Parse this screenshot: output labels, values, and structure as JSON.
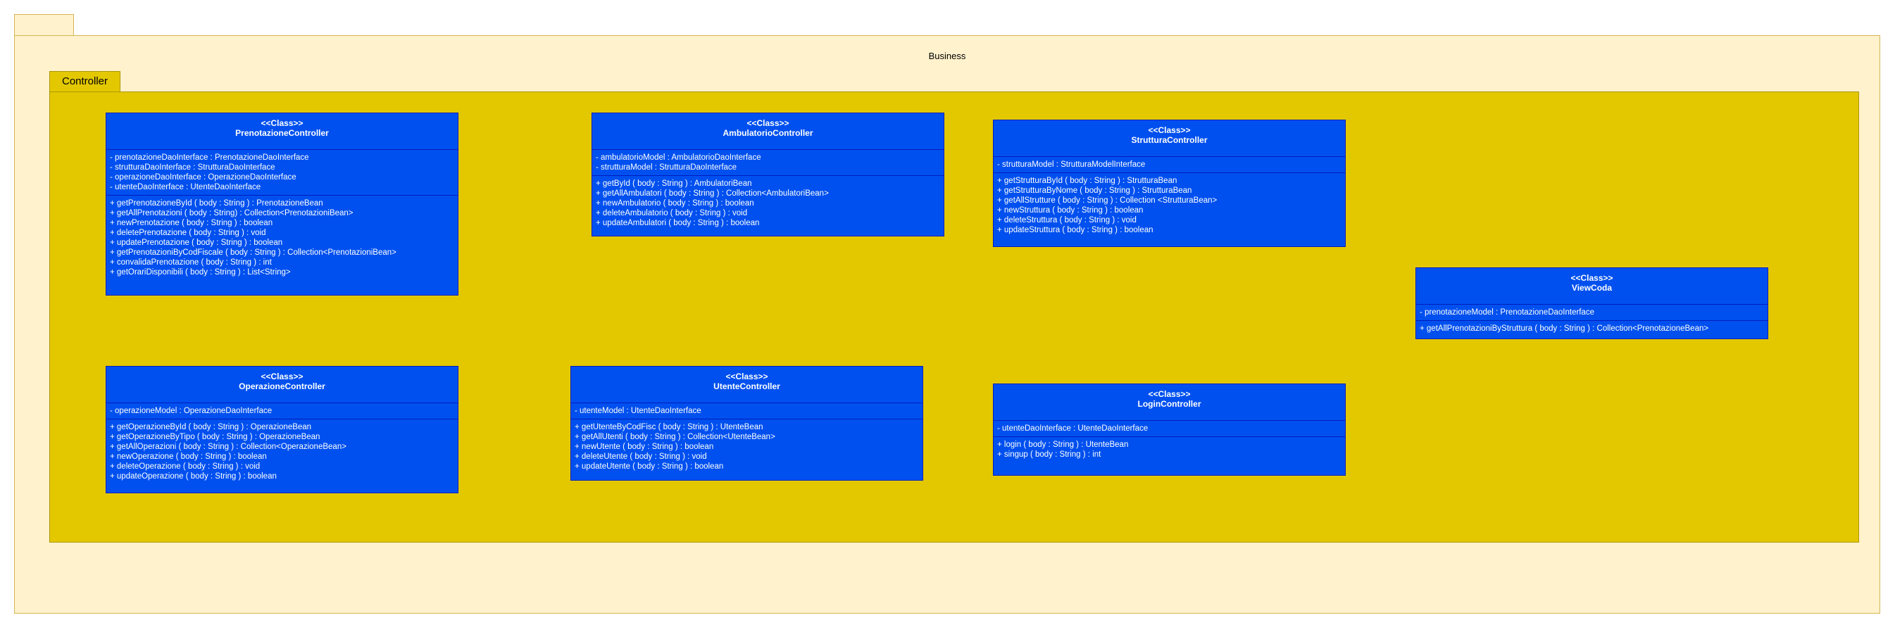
{
  "package": {
    "name": "Business"
  },
  "subpackage": {
    "name": "Controller"
  },
  "classes": [
    {
      "stereotype": "<<Class>>",
      "name": "PrenotazioneController",
      "attributes": [
        "- prenotazioneDaoInterface : PrenotazioneDaoInterface",
        "- strutturaDaoInterface : StrutturaDaoInterface",
        "- operazioneDaoInterface : OperazioneDaoInterface",
        "- utenteDaoInterface : UtenteDaoInterface"
      ],
      "methods": [
        "+ getPrenotazioneById ( body : String ) : PrenotazioneBean",
        "+ getAllPrenotazioni ( body : String) : Collection<PrenotazioniBean>",
        "+ newPrenotazione ( body : String ) : boolean",
        "+ deletePrenotazione ( body : String ) : void",
        "+ updatePrenotazione ( body : String ) : boolean",
        "+ getPrenotazioniByCodFiscale ( body : String ) : Collection<PrenotazioniBean>",
        "+ convalidaPrenotazione ( body : String ) : int",
        "+ getOrariDisponibili ( body : String ) : List<String>"
      ]
    },
    {
      "stereotype": "<<Class>>",
      "name": "AmbulatorioController",
      "attributes": [
        "- ambulatorioModel : AmbulatorioDaoInterface",
        "- strutturaModel : StrutturaDaoInterface"
      ],
      "methods": [
        "+ getById ( body : String ) : AmbulatoriBean",
        "+ getAllAmbulatori ( body : String ) : Collection<AmbulatoriBean>",
        "+ newAmbulatorio ( body : String ) : boolean",
        "+ deleteAmbulatorio ( body : String ) : void",
        "+ updateAmbulatori ( body : String ) : boolean"
      ]
    },
    {
      "stereotype": "<<Class>>",
      "name": "StrutturaController",
      "attributes": [
        "- strutturaModel : StrutturaModelInterface"
      ],
      "methods": [
        "+ getStrutturaById ( body : String ) : StrutturaBean",
        "+ getStrutturaByNome ( body : String ) : StrutturaBean",
        "+ getAllStrutture ( body : String ) : Collection <StrutturaBean>",
        "+ newStruttura ( body : String ) : boolean",
        "+ deleteStruttura ( body : String ) : void",
        "+ updateStruttura ( body : String ) : boolean"
      ]
    },
    {
      "stereotype": "<<Class>>",
      "name": "ViewCoda",
      "attributes": [
        "- prenotazioneModel : PrenotazioneDaoInterface"
      ],
      "methods": [
        "+ getAllPrenotazioniByStruttura ( body : String ) : Collection<PrenotazioneBean>"
      ]
    },
    {
      "stereotype": "<<Class>>",
      "name": "OperazioneController",
      "attributes": [
        "- operazioneModel : OperazioneDaoInterface"
      ],
      "methods": [
        "+ getOperazioneById ( body : String ) : OperazioneBean",
        "+ getOperazioneByTipo ( body : String ) : OperazioneBean",
        "+ getAllOperazioni ( body : String ) : Collection<OperazioneBean>",
        "+ newOperazione ( body : String ) : boolean",
        "+ deleteOperazione ( body : String ) : void",
        "+ updateOperazione ( body : String ) : boolean"
      ]
    },
    {
      "stereotype": "<<Class>>",
      "name": "UtenteController",
      "attributes": [
        "- utenteModel : UtenteDaoInterface"
      ],
      "methods": [
        "+ getUtenteByCodFisc ( body : String ) : UtenteBean",
        "+ getAllUtenti ( body : String ) : Collection<UtenteBean>",
        "+ newUtente ( body : String ) : boolean",
        "+ deleteUtente ( body : String ) : void",
        "+ updateUtente ( body : String ) : boolean"
      ]
    },
    {
      "stereotype": "<<Class>>",
      "name": "LoginController",
      "attributes": [
        "- utenteDaoInterface : UtenteDaoInterface"
      ],
      "methods": [
        "+ login ( body : String ) : UtenteBean",
        "+ singup ( body : String ) : int"
      ]
    }
  ]
}
